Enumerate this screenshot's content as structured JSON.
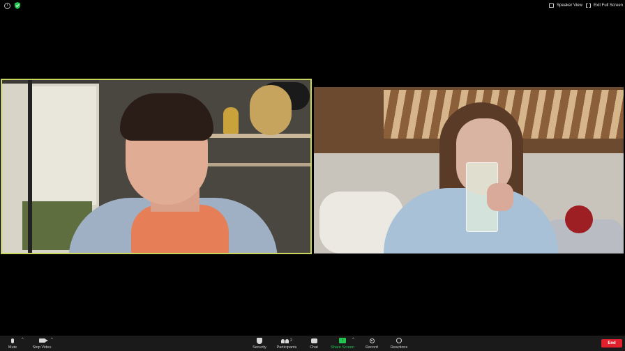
{
  "topbar": {
    "speaker_view_label": "Speaker View",
    "exit_full_screen_label": "Exit Full Screen"
  },
  "participants_tiles": [
    {
      "position": "left",
      "active_speaker": true,
      "highlight_color": "#c8d65a"
    },
    {
      "position": "right",
      "active_speaker": false
    }
  ],
  "toolbar": {
    "mute_label": "Mute",
    "stop_video_label": "Stop Video",
    "security_label": "Security",
    "participants_label": "Participants",
    "participants_count": "2",
    "chat_label": "Chat",
    "share_screen_label": "Share Screen",
    "record_label": "Record",
    "reactions_label": "Reactions",
    "end_label": "End",
    "share_color": "#23c552",
    "end_color": "#e0202c"
  },
  "icons": [
    "info-icon",
    "shield-icon",
    "grid-icon",
    "fullscreen-icon",
    "microphone-icon",
    "video-camera-icon",
    "shield-icon",
    "participants-icon",
    "chat-bubble-icon",
    "share-screen-icon",
    "record-icon",
    "reaction-icon"
  ]
}
